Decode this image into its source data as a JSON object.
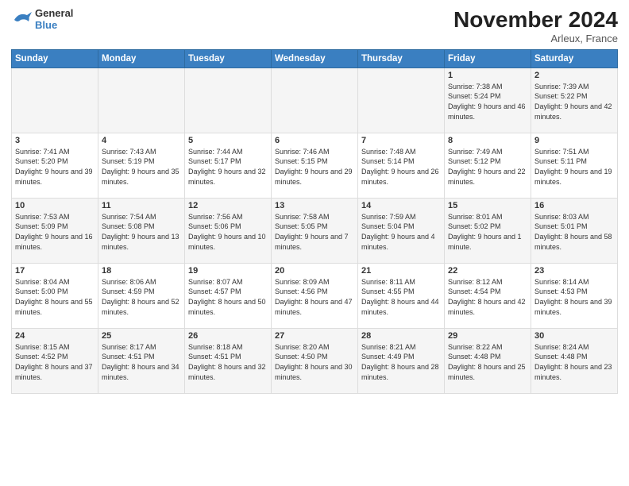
{
  "logo": {
    "general": "General",
    "blue": "Blue"
  },
  "header": {
    "month_year": "November 2024",
    "location": "Arleux, France"
  },
  "days_of_week": [
    "Sunday",
    "Monday",
    "Tuesday",
    "Wednesday",
    "Thursday",
    "Friday",
    "Saturday"
  ],
  "weeks": [
    [
      {
        "day": "",
        "info": ""
      },
      {
        "day": "",
        "info": ""
      },
      {
        "day": "",
        "info": ""
      },
      {
        "day": "",
        "info": ""
      },
      {
        "day": "",
        "info": ""
      },
      {
        "day": "1",
        "info": "Sunrise: 7:38 AM\nSunset: 5:24 PM\nDaylight: 9 hours and 46 minutes."
      },
      {
        "day": "2",
        "info": "Sunrise: 7:39 AM\nSunset: 5:22 PM\nDaylight: 9 hours and 42 minutes."
      }
    ],
    [
      {
        "day": "3",
        "info": "Sunrise: 7:41 AM\nSunset: 5:20 PM\nDaylight: 9 hours and 39 minutes."
      },
      {
        "day": "4",
        "info": "Sunrise: 7:43 AM\nSunset: 5:19 PM\nDaylight: 9 hours and 35 minutes."
      },
      {
        "day": "5",
        "info": "Sunrise: 7:44 AM\nSunset: 5:17 PM\nDaylight: 9 hours and 32 minutes."
      },
      {
        "day": "6",
        "info": "Sunrise: 7:46 AM\nSunset: 5:15 PM\nDaylight: 9 hours and 29 minutes."
      },
      {
        "day": "7",
        "info": "Sunrise: 7:48 AM\nSunset: 5:14 PM\nDaylight: 9 hours and 26 minutes."
      },
      {
        "day": "8",
        "info": "Sunrise: 7:49 AM\nSunset: 5:12 PM\nDaylight: 9 hours and 22 minutes."
      },
      {
        "day": "9",
        "info": "Sunrise: 7:51 AM\nSunset: 5:11 PM\nDaylight: 9 hours and 19 minutes."
      }
    ],
    [
      {
        "day": "10",
        "info": "Sunrise: 7:53 AM\nSunset: 5:09 PM\nDaylight: 9 hours and 16 minutes."
      },
      {
        "day": "11",
        "info": "Sunrise: 7:54 AM\nSunset: 5:08 PM\nDaylight: 9 hours and 13 minutes."
      },
      {
        "day": "12",
        "info": "Sunrise: 7:56 AM\nSunset: 5:06 PM\nDaylight: 9 hours and 10 minutes."
      },
      {
        "day": "13",
        "info": "Sunrise: 7:58 AM\nSunset: 5:05 PM\nDaylight: 9 hours and 7 minutes."
      },
      {
        "day": "14",
        "info": "Sunrise: 7:59 AM\nSunset: 5:04 PM\nDaylight: 9 hours and 4 minutes."
      },
      {
        "day": "15",
        "info": "Sunrise: 8:01 AM\nSunset: 5:02 PM\nDaylight: 9 hours and 1 minute."
      },
      {
        "day": "16",
        "info": "Sunrise: 8:03 AM\nSunset: 5:01 PM\nDaylight: 8 hours and 58 minutes."
      }
    ],
    [
      {
        "day": "17",
        "info": "Sunrise: 8:04 AM\nSunset: 5:00 PM\nDaylight: 8 hours and 55 minutes."
      },
      {
        "day": "18",
        "info": "Sunrise: 8:06 AM\nSunset: 4:59 PM\nDaylight: 8 hours and 52 minutes."
      },
      {
        "day": "19",
        "info": "Sunrise: 8:07 AM\nSunset: 4:57 PM\nDaylight: 8 hours and 50 minutes."
      },
      {
        "day": "20",
        "info": "Sunrise: 8:09 AM\nSunset: 4:56 PM\nDaylight: 8 hours and 47 minutes."
      },
      {
        "day": "21",
        "info": "Sunrise: 8:11 AM\nSunset: 4:55 PM\nDaylight: 8 hours and 44 minutes."
      },
      {
        "day": "22",
        "info": "Sunrise: 8:12 AM\nSunset: 4:54 PM\nDaylight: 8 hours and 42 minutes."
      },
      {
        "day": "23",
        "info": "Sunrise: 8:14 AM\nSunset: 4:53 PM\nDaylight: 8 hours and 39 minutes."
      }
    ],
    [
      {
        "day": "24",
        "info": "Sunrise: 8:15 AM\nSunset: 4:52 PM\nDaylight: 8 hours and 37 minutes."
      },
      {
        "day": "25",
        "info": "Sunrise: 8:17 AM\nSunset: 4:51 PM\nDaylight: 8 hours and 34 minutes."
      },
      {
        "day": "26",
        "info": "Sunrise: 8:18 AM\nSunset: 4:51 PM\nDaylight: 8 hours and 32 minutes."
      },
      {
        "day": "27",
        "info": "Sunrise: 8:20 AM\nSunset: 4:50 PM\nDaylight: 8 hours and 30 minutes."
      },
      {
        "day": "28",
        "info": "Sunrise: 8:21 AM\nSunset: 4:49 PM\nDaylight: 8 hours and 28 minutes."
      },
      {
        "day": "29",
        "info": "Sunrise: 8:22 AM\nSunset: 4:48 PM\nDaylight: 8 hours and 25 minutes."
      },
      {
        "day": "30",
        "info": "Sunrise: 8:24 AM\nSunset: 4:48 PM\nDaylight: 8 hours and 23 minutes."
      }
    ]
  ]
}
